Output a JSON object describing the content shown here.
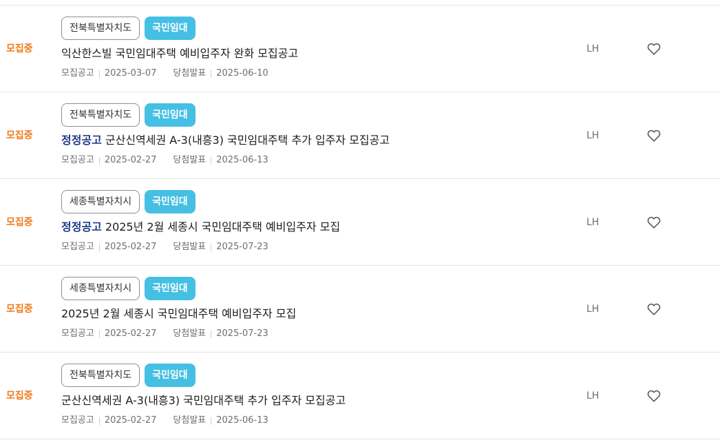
{
  "listings": [
    {
      "status": "모집중",
      "region": "전북특별자치도",
      "type": "국민임대",
      "correction": "",
      "title": "익산한스빌 국민임대주택 예비입주자 완화 모집공고",
      "notice_label": "모집공고",
      "notice_date": "2025-03-07",
      "winner_label": "당첨발표",
      "winner_date": "2025-06-10",
      "org": "LH",
      "favorite_icon": "heart-outline-icon"
    },
    {
      "status": "모집중",
      "region": "전북특별자치도",
      "type": "국민임대",
      "correction": "정정공고",
      "title": "군산신역세권 A-3(내흥3) 국민임대주택 추가 입주자 모집공고",
      "notice_label": "모집공고",
      "notice_date": "2025-02-27",
      "winner_label": "당첨발표",
      "winner_date": "2025-06-13",
      "org": "LH",
      "favorite_icon": "heart-outline-icon"
    },
    {
      "status": "모집중",
      "region": "세종특별자치시",
      "type": "국민임대",
      "correction": "정정공고",
      "title": "2025년 2월 세종시 국민임대주택 예비입주자 모집",
      "notice_label": "모집공고",
      "notice_date": "2025-02-27",
      "winner_label": "당첨발표",
      "winner_date": "2025-07-23",
      "org": "LH",
      "favorite_icon": "heart-outline-icon"
    },
    {
      "status": "모집중",
      "region": "세종특별자치시",
      "type": "국민임대",
      "correction": "",
      "title": "2025년 2월 세종시 국민임대주택 예비입주자 모집",
      "notice_label": "모집공고",
      "notice_date": "2025-02-27",
      "winner_label": "당첨발표",
      "winner_date": "2025-07-23",
      "org": "LH",
      "favorite_icon": "heart-outline-icon"
    },
    {
      "status": "모집중",
      "region": "전북특별자치도",
      "type": "국민임대",
      "correction": "",
      "title": "군산신역세권 A-3(내흥3) 국민임대주택 추가 입주자 모집공고",
      "notice_label": "모집공고",
      "notice_date": "2025-02-27",
      "winner_label": "당첨발표",
      "winner_date": "2025-06-13",
      "org": "LH",
      "favorite_icon": "heart-outline-icon"
    }
  ],
  "colors": {
    "status": "#f07a1a",
    "type_badge": "#45bfe3",
    "correction": "#1f3b87"
  }
}
